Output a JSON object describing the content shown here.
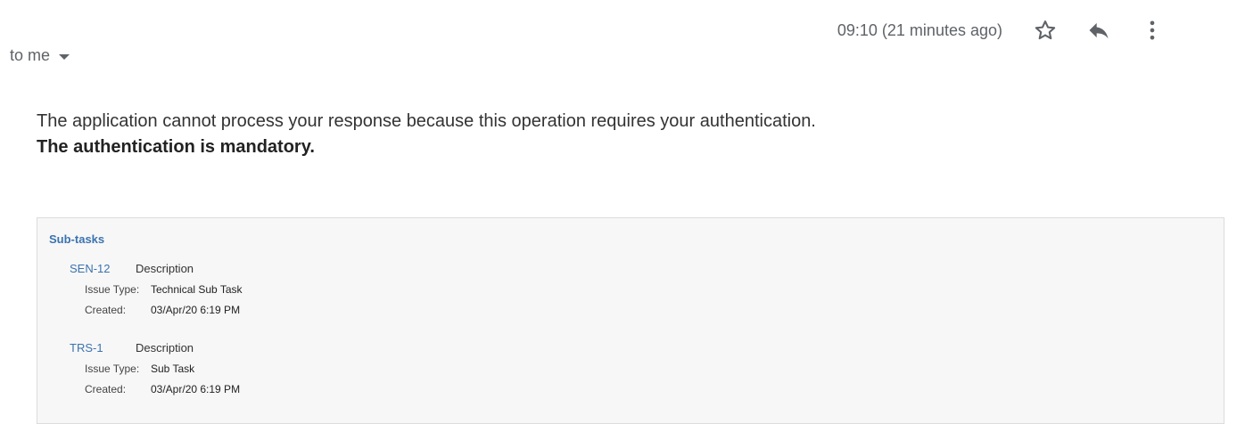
{
  "header": {
    "timestamp": "09:10 (21 minutes ago)",
    "icons": [
      "star-icon",
      "reply-icon",
      "more-vert-icon"
    ]
  },
  "recipient": {
    "label": "to me"
  },
  "message": {
    "line1": "The application cannot process your response because this operation requires your authentication.",
    "line2": "The authentication is mandatory."
  },
  "subtasks": {
    "title": "Sub-tasks",
    "items": [
      {
        "key": "SEN-12",
        "description": "Description",
        "issue_type_label": "Issue Type:",
        "issue_type": "Technical Sub Task",
        "created_label": "Created:",
        "created": "03/Apr/20 6:19 PM"
      },
      {
        "key": "TRS-1",
        "description": "Description",
        "issue_type_label": "Issue Type:",
        "issue_type": "Sub Task",
        "created_label": "Created:",
        "created": "03/Apr/20 6:19 PM"
      }
    ]
  },
  "colors": {
    "link": "#3b73af",
    "muted": "#5f6368",
    "box_bg": "#f7f7f7"
  }
}
